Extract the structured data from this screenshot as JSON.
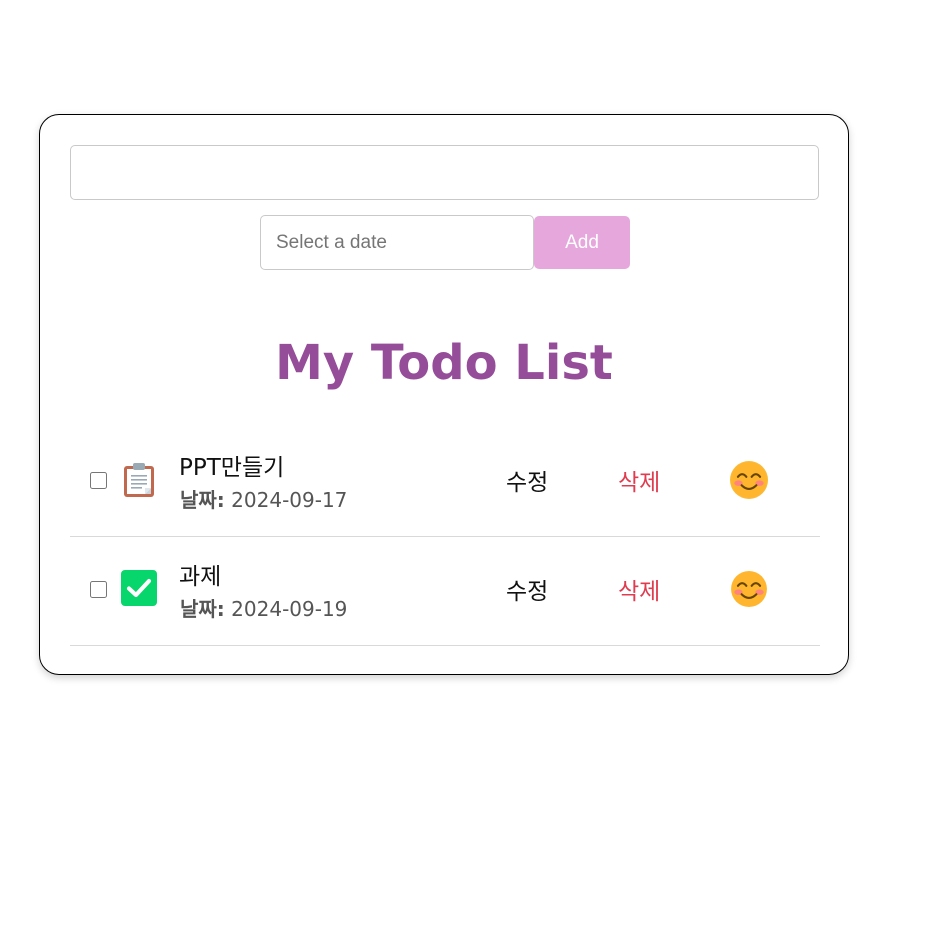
{
  "form": {
    "todo_value": "",
    "date_placeholder": "Select a date",
    "add_label": "Add"
  },
  "title": "My Todo List",
  "todos": [
    {
      "text": "PPT만들기",
      "date_label": "날짜:",
      "date": "2024-09-17",
      "checked": false,
      "icon": "clipboard-icon",
      "edit_label": "수정",
      "delete_label": "삭제",
      "reaction_icon": "smiling-face-icon"
    },
    {
      "text": "과제",
      "date_label": "날짜:",
      "date": "2024-09-19",
      "checked": false,
      "icon": "check-mark-button-icon",
      "edit_label": "수정",
      "delete_label": "삭제",
      "reaction_icon": "smiling-face-icon"
    }
  ],
  "colors": {
    "title": "#954c99",
    "add_button": "#e6a7dd",
    "delete": "#e03c4f"
  }
}
